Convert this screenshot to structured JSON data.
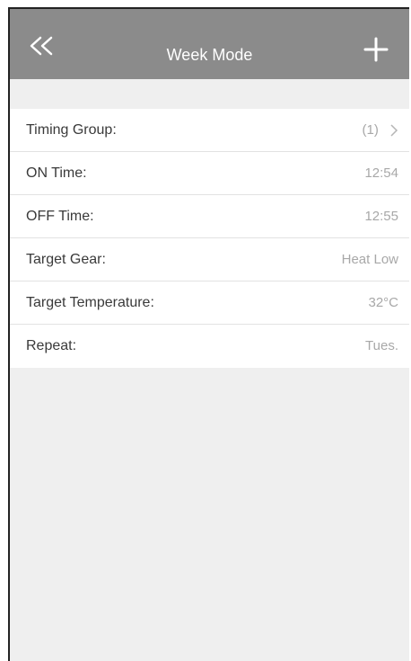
{
  "header": {
    "title": "Week Mode",
    "back_icon": "double-chevron-left-icon",
    "add_icon": "plus-icon"
  },
  "settings": {
    "rows": [
      {
        "label": "Timing Group:",
        "value": "(1)"
      },
      {
        "label": "ON Time:",
        "value": "12:54"
      },
      {
        "label": "OFF Time:",
        "value": "12:55"
      },
      {
        "label": "Target Gear:",
        "value": "Heat Low"
      },
      {
        "label": "Target Temperature:",
        "value": "32°C"
      },
      {
        "label": "Repeat:",
        "value": "Tues."
      }
    ]
  },
  "colors": {
    "navbar": "#8b8b8b",
    "background": "#efefef",
    "label_text": "#3a3a3a",
    "value_text": "#a8a8a8"
  }
}
